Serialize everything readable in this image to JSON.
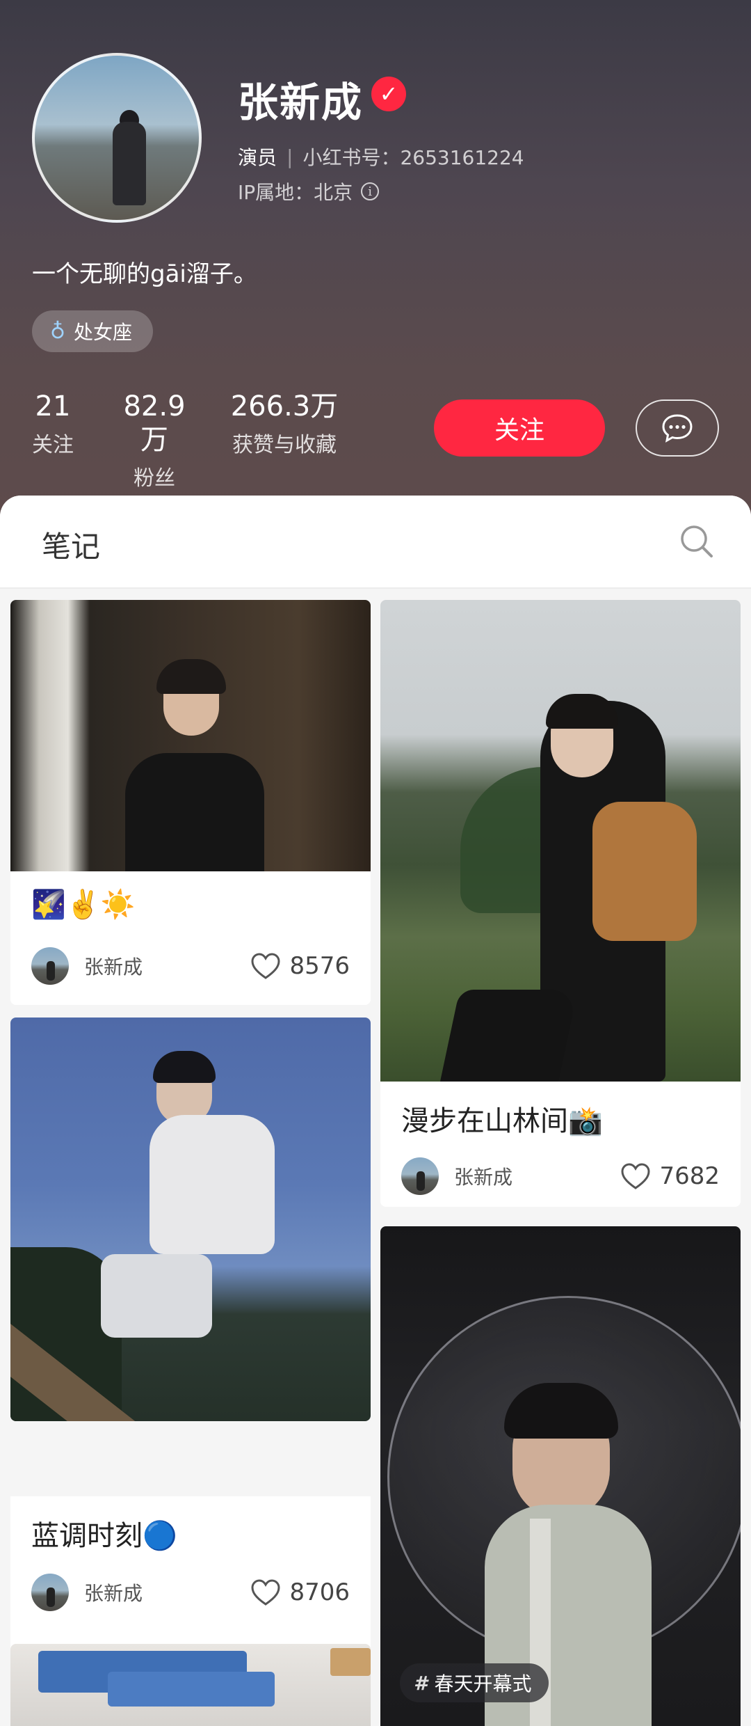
{
  "profile": {
    "name": "张新成",
    "role": "演员",
    "red_id": "小红书号：2653161224",
    "ip": "IP属地：北京",
    "bio": "一个无聊的gāi溜子。",
    "tag": "处女座"
  },
  "stats": [
    {
      "value": "21",
      "label": "关注"
    },
    {
      "value": "82.9万",
      "label": "粉丝"
    },
    {
      "value": "266.3万",
      "label": "获赞与收藏"
    }
  ],
  "actions": {
    "follow": "关注"
  },
  "notes": {
    "title": "笔记",
    "cards": [
      {
        "title": "🌠✌️☀️",
        "author": "张新成",
        "likes": "8576"
      },
      {
        "title": "漫步在山林间📸",
        "author": "张新成",
        "likes": "7682"
      },
      {
        "title": "蓝调时刻🔵",
        "author": "张新成",
        "likes": "8706"
      },
      {
        "title": "",
        "author": "",
        "likes": "",
        "hashtag": "春天开幕式"
      }
    ]
  },
  "colors": {
    "accent": "#ff2741",
    "header_top": "#3c3a45",
    "header_bottom": "#5e4b4b"
  }
}
